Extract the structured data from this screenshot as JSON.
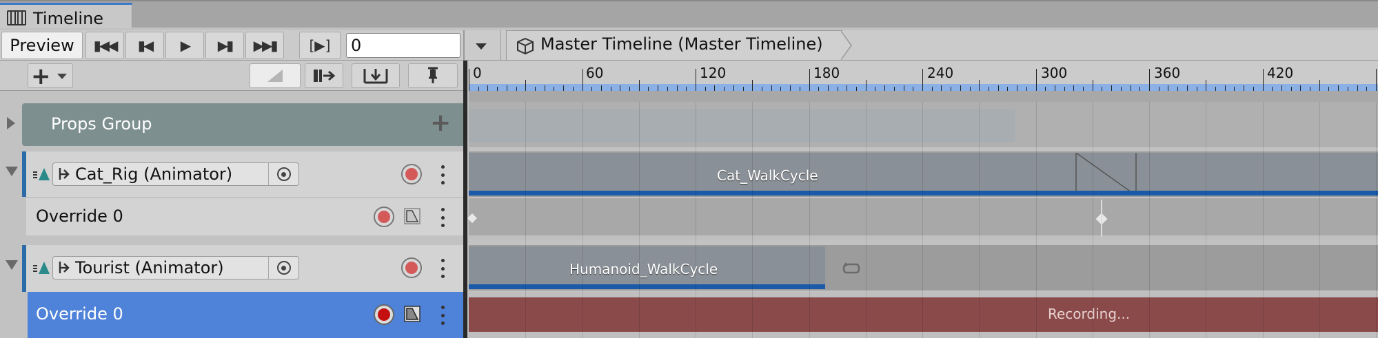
{
  "window": {
    "tab_title": "Timeline"
  },
  "toolbar": {
    "preview_label": "Preview",
    "frame_value": "0",
    "breadcrumb": "Master Timeline (Master Timeline)"
  },
  "ruler": {
    "labels": [
      "0",
      "60",
      "120",
      "180",
      "240",
      "300",
      "360",
      "420"
    ]
  },
  "group": {
    "label": "Props Group"
  },
  "tracks": [
    {
      "binding": "Cat_Rig (Animator)",
      "override": "Override 0",
      "clip": "Cat_WalkCycle"
    },
    {
      "binding": "Tourist (Animator)",
      "override": "Override 0",
      "clip": "Humanoid_WalkCycle",
      "recording": "Recording..."
    }
  ],
  "colors": {
    "selection": "#4f82d9",
    "clip": "#8a9097",
    "recording": "#8a4a4a",
    "group": "#7d8f8f",
    "accent_blue": "#1b5aa8"
  },
  "icons": [
    "film-icon",
    "go-to-start-icon",
    "previous-frame-icon",
    "play-icon",
    "next-frame-icon",
    "go-to-end-icon",
    "play-range-icon",
    "cube-icon",
    "add-icon",
    "record-icon",
    "curve-icon",
    "target-icon",
    "loop-icon"
  ]
}
